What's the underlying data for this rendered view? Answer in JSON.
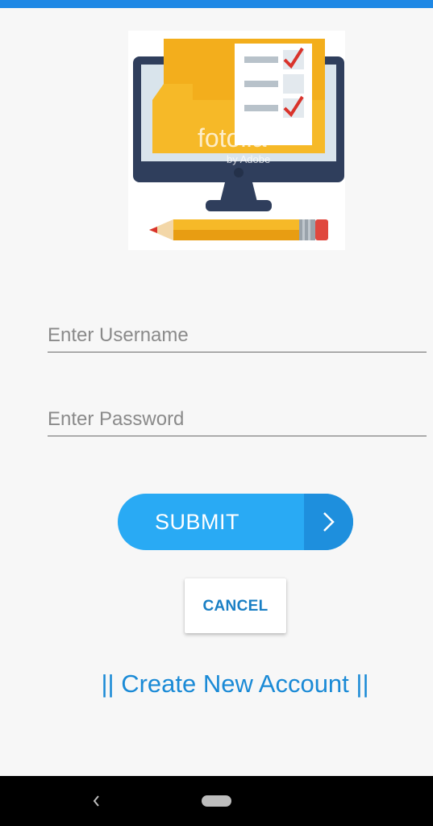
{
  "illustration": {
    "watermark_main": "fotolia",
    "watermark_sub": "by Adobe"
  },
  "form": {
    "username_placeholder": "Enter Username",
    "password_placeholder": "Enter Password"
  },
  "buttons": {
    "submit_label": "SUBMIT",
    "cancel_label": "CANCEL"
  },
  "links": {
    "create_account": "|| Create New Account ||"
  },
  "colors": {
    "status_bar": "#1e88e5",
    "submit_bg": "#29aaf4",
    "accent_text": "#1a8ad6"
  },
  "icons": {
    "submit_arrow": "chevron-right-icon",
    "nav_back": "back-icon",
    "nav_home": "home-pill-icon"
  }
}
